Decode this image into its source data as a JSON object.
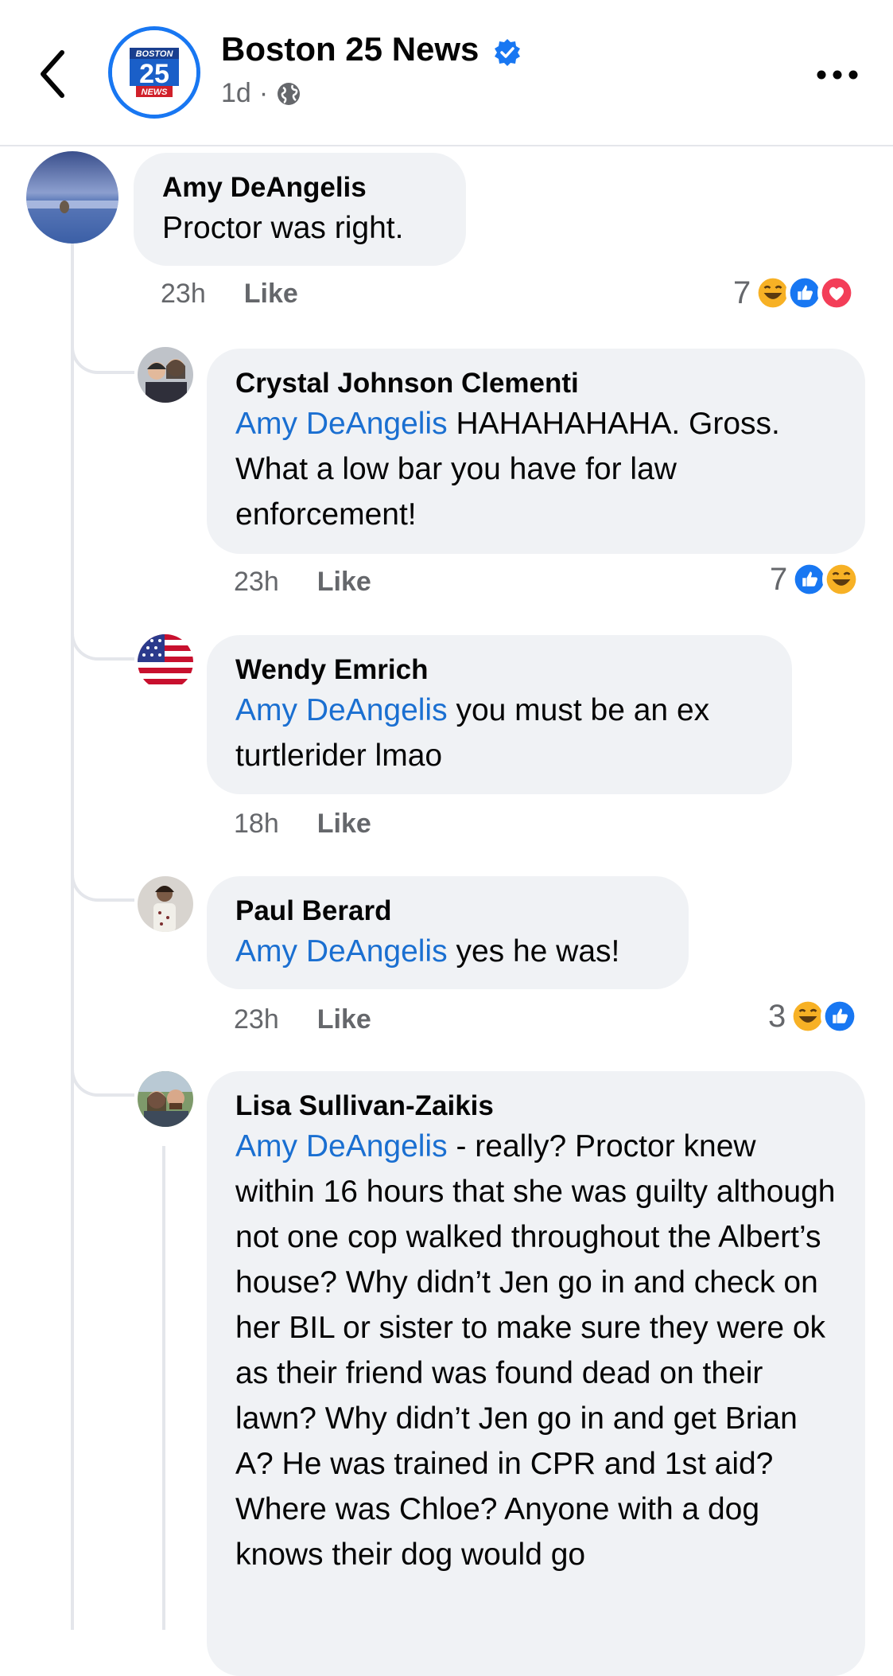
{
  "header": {
    "page_name": "Boston 25 News",
    "logo_text": {
      "top": "BOSTON",
      "num": "25",
      "bottom": "NEWS"
    },
    "time": "1d",
    "separator": "·",
    "accent": "#1877f2"
  },
  "comments": [
    {
      "author": "Amy DeAngelis",
      "mention": "",
      "text": "Proctor was right.",
      "time": "23h",
      "like_label": "Like",
      "reaction_count": "7",
      "reactions": [
        "haha",
        "like",
        "love"
      ]
    },
    {
      "author": "Crystal Johnson Clementi",
      "mention": "Amy DeAngelis",
      "text": " HAHAHAHAHA. Gross. What a low bar you have for law enforcement!",
      "time": "23h",
      "like_label": "Like",
      "reaction_count": "7",
      "reactions": [
        "like",
        "haha"
      ]
    },
    {
      "author": "Wendy Emrich",
      "mention": "Amy DeAngelis",
      "text": " you must be an ex turtlerider lmao",
      "time": "18h",
      "like_label": "Like",
      "reaction_count": "",
      "reactions": []
    },
    {
      "author": "Paul Berard",
      "mention": "Amy DeAngelis",
      "text": " yes he was!",
      "time": "23h",
      "like_label": "Like",
      "reaction_count": "3",
      "reactions": [
        "haha",
        "like"
      ]
    },
    {
      "author": "Lisa Sullivan-Zaikis",
      "mention": "Amy DeAngelis",
      "text": " - really?  Proctor knew within 16 hours that she was guilty although not one cop walked throughout the Albert’s house?  Why didn’t Jen go in and check on her BIL or sister to make sure they were ok as their friend was found dead on their lawn? Why didn’t Jen go in and get Brian A?  He was trained in CPR and 1st aid?  Where was Chloe?  Anyone with a dog knows their dog would go",
      "time": "",
      "like_label": "",
      "reaction_count": "",
      "reactions": []
    }
  ],
  "colors": {
    "bubble": "#f0f2f5",
    "mention": "#1a6fd1",
    "meta": "#65676b",
    "like_reaction": "#1877f2",
    "love_reaction": "#f33e58",
    "haha_reaction": "#f7b125"
  }
}
